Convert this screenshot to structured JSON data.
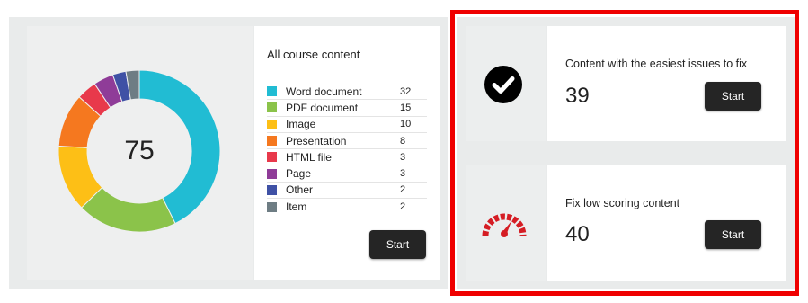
{
  "summary": {
    "total": "75",
    "title": "All course content",
    "start_label": "Start",
    "items": [
      {
        "label": "Word document",
        "count": "32",
        "color": "#21bcd3"
      },
      {
        "label": "PDF document",
        "count": "15",
        "color": "#8bc34a"
      },
      {
        "label": "Image",
        "count": "10",
        "color": "#fdbf16"
      },
      {
        "label": "Presentation",
        "count": "8",
        "color": "#f5781f"
      },
      {
        "label": "HTML file",
        "count": "3",
        "color": "#e8394b"
      },
      {
        "label": "Page",
        "count": "3",
        "color": "#8f3c98"
      },
      {
        "label": "Other",
        "count": "2",
        "color": "#3f51a5"
      },
      {
        "label": "Item",
        "count": "2",
        "color": "#6e7d84"
      }
    ]
  },
  "easiest": {
    "title": "Content with the easiest issues to fix",
    "count": "39",
    "start_label": "Start",
    "icon": "checkmark-circle-icon"
  },
  "low_scoring": {
    "title": "Fix low scoring content",
    "count": "40",
    "start_label": "Start",
    "icon": "gauge-icon",
    "icon_color": "#d51d24"
  },
  "highlight_color": "#ef0000"
}
